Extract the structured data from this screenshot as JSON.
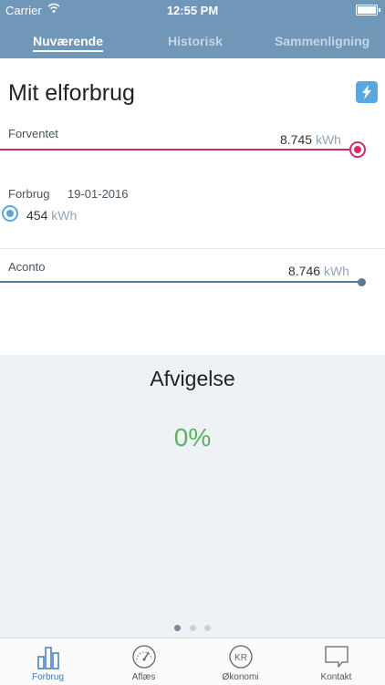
{
  "status_bar": {
    "carrier": "Carrier",
    "time": "12:55 PM"
  },
  "tabs": [
    {
      "label": "Nuværende",
      "active": true
    },
    {
      "label": "Historisk",
      "active": false
    },
    {
      "label": "Sammenligning",
      "active": false
    }
  ],
  "main": {
    "title": "Mit elforbrug",
    "forventet": {
      "label": "Forventet",
      "value": "8.745",
      "unit": "kWh"
    },
    "forbrug": {
      "label": "Forbrug",
      "date": "19-01-2016",
      "value": "454",
      "unit": "kWh"
    },
    "aconto": {
      "label": "Aconto",
      "value": "8.746",
      "unit": "kWh"
    }
  },
  "deviation": {
    "heading": "Afvigelse",
    "value": "0%"
  },
  "pager": {
    "pages": 3,
    "current": 1
  },
  "tabbar": [
    {
      "label": "Forbrug",
      "icon": "bar-chart-icon",
      "active": true
    },
    {
      "label": "Aflæs",
      "icon": "speedometer-icon",
      "active": false
    },
    {
      "label": "Økonomi",
      "icon": "kr-coin-icon",
      "active": false
    },
    {
      "label": "Kontakt",
      "icon": "chat-bubble-icon",
      "active": false
    }
  ],
  "colors": {
    "header": "#7096b8",
    "forventet": "#d12b68",
    "forbrug": "#5aa7e0",
    "aconto": "#5d7891",
    "deviation_text": "#59b35d",
    "active_tab": "#3a7cc2"
  }
}
